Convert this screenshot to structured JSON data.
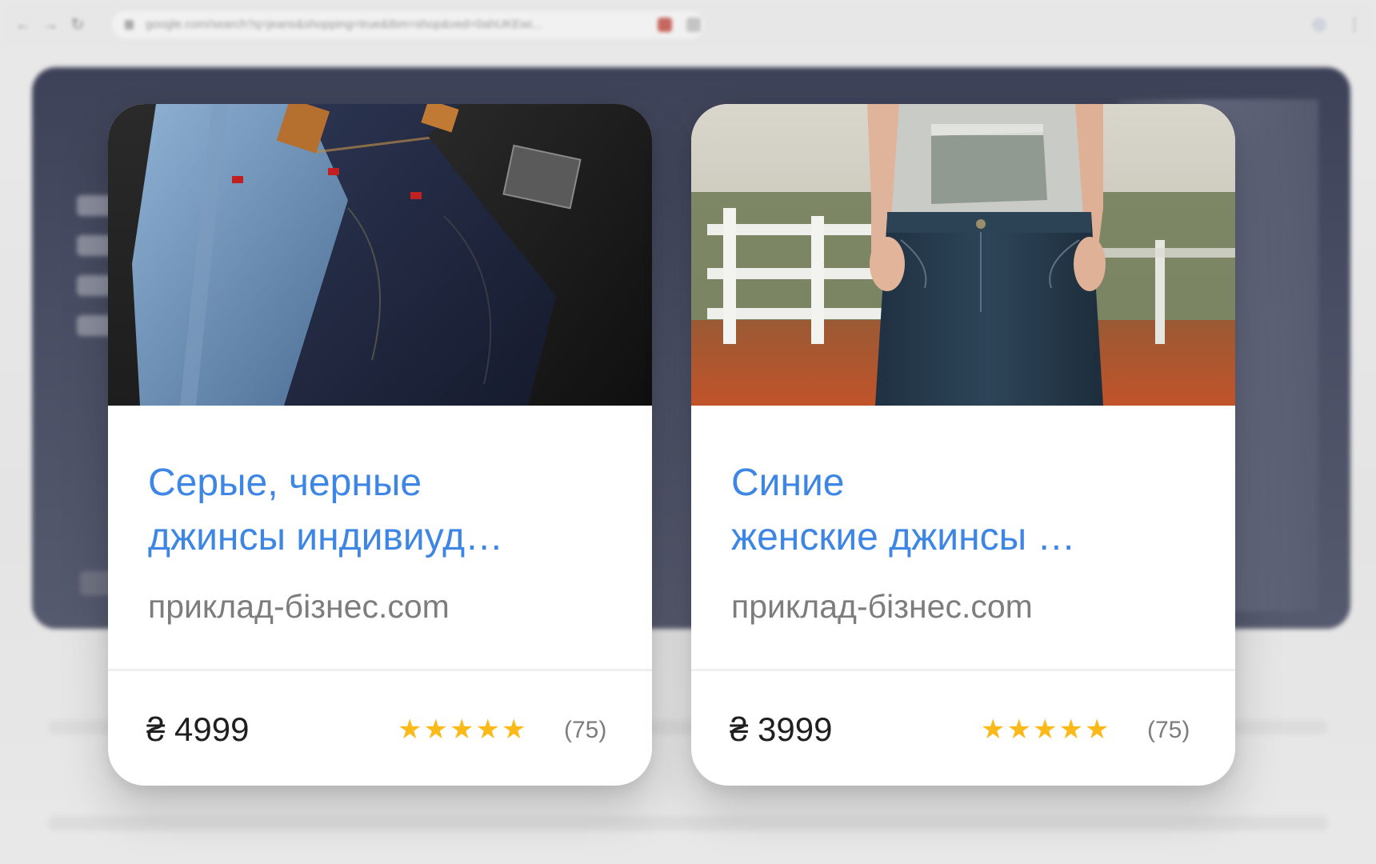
{
  "browser": {
    "url": "google.com/search?q=jeans&shopping=true&tbm=shop&ved=0ahUKEwi..."
  },
  "products": [
    {
      "title_line1": "Серые, черные",
      "title_line2": "джинсы индивиуд…",
      "domain": "приклад-бізнес.com",
      "price": "₴ 4999",
      "rating": 5,
      "reviews": "(75)",
      "image_icon": "folded-jeans-image"
    },
    {
      "title_line1": "Синие",
      "title_line2": "женские джинсы …",
      "domain": "приклад-бізнес.com",
      "price": "₴ 3999",
      "rating": 5,
      "reviews": "(75)",
      "image_icon": "woman-in-jeans-image"
    }
  ],
  "colors": {
    "title": "#3d86e6",
    "star": "#fbba1a",
    "domain": "#7d7d7d"
  }
}
